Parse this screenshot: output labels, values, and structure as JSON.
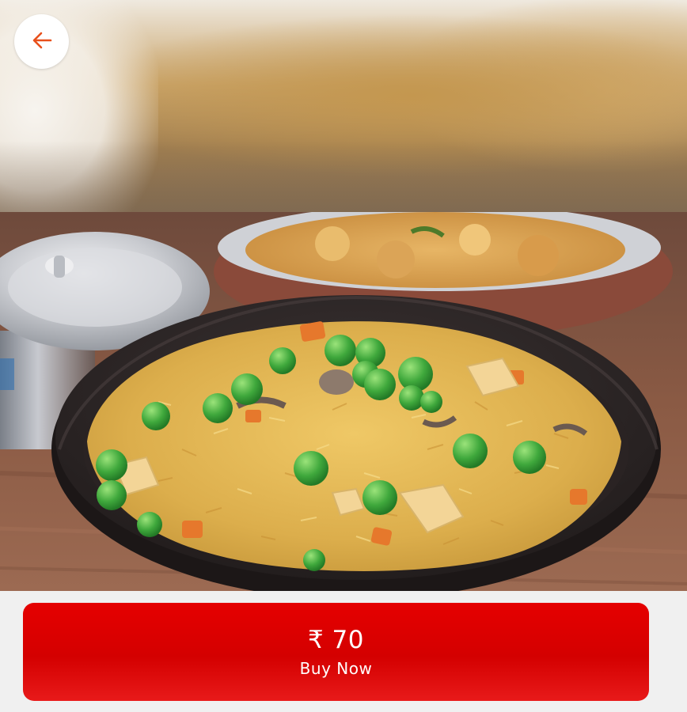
{
  "header": {
    "back_icon": "arrow-left-icon",
    "accent_color": "#e8501c"
  },
  "product": {
    "image_icon": "vegetable-pulao-photo"
  },
  "purchase": {
    "price": "₹ 70",
    "button_label": "Buy Now",
    "button_color": "#e00000"
  }
}
